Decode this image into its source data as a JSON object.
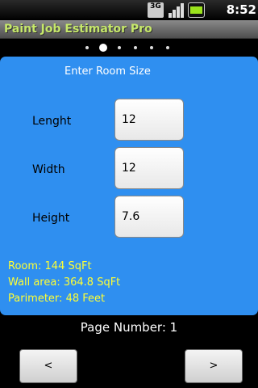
{
  "status_bar": {
    "network_label": "3G",
    "time": "8:52 AM",
    "icons": [
      "3g-data-icon",
      "signal-strength-icon",
      "battery-charging-icon"
    ]
  },
  "app": {
    "title": "Paint Job Estimator Pro"
  },
  "pager": {
    "dots_count": 5,
    "active_index": 0
  },
  "form": {
    "heading": "Enter Room Size",
    "fields": [
      {
        "label": "Lenght",
        "value": "12"
      },
      {
        "label": "Width",
        "value": "12"
      },
      {
        "label": "Height",
        "value": "7.6"
      }
    ]
  },
  "results": {
    "room": "Room: 144 SqFt",
    "wall_area": "Wall area: 364.8 SqFt",
    "perimeter": "Parimeter: 48 Feet"
  },
  "footer": {
    "page_number": "Page Number: 1",
    "prev_label": "<",
    "next_label": ">"
  },
  "colors": {
    "panel_bg": "#2f8ff0",
    "result_text": "#ffff33",
    "title_text": "#c6e86a"
  }
}
